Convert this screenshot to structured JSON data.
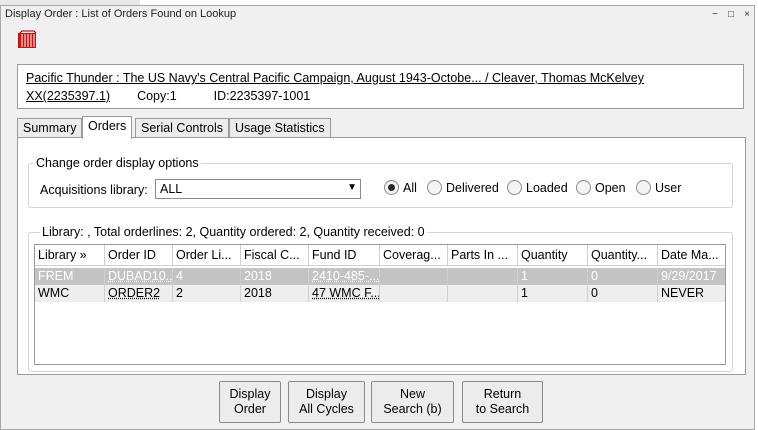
{
  "window": {
    "title": "Display Order : List of Orders Found on Lookup",
    "controls": {
      "minimize": "−",
      "maximize": "□",
      "close": "×"
    }
  },
  "record": {
    "title_line": "Pacific Thunder : The US Navy's Central Pacific Campaign, August 1943-Octobe... / Cleaver, Thomas McKelvey",
    "call_number": "XX(2235397.1)",
    "copy": "Copy:1",
    "id": "ID:2235397-1001"
  },
  "tabs": [
    {
      "label": "Summary",
      "active": false
    },
    {
      "label": "Orders",
      "active": true
    },
    {
      "label": "Serial Controls",
      "active": false
    },
    {
      "label": "Usage Statistics",
      "active": false
    }
  ],
  "options": {
    "legend": "Change order display options",
    "acq_label": "Acquisitions library:",
    "acq_value": "ALL",
    "radios": [
      {
        "label": "All",
        "checked": true
      },
      {
        "label": "Delivered",
        "checked": false
      },
      {
        "label": "Loaded",
        "checked": false
      },
      {
        "label": "Open",
        "checked": false
      },
      {
        "label": "User",
        "checked": false
      }
    ]
  },
  "summary": {
    "legend": "Library: , Total orderlines: 2, Quantity ordered: 2, Quantity received: 0"
  },
  "table": {
    "columns": [
      "Library »",
      "Order ID",
      "Order Li...",
      "Fiscal C...",
      "Fund ID",
      "Coverag...",
      "Parts In ...",
      "Quantity",
      "Quantity...",
      "Date Ma..."
    ],
    "rows": [
      [
        "FREM",
        "DUBAD10...",
        "4",
        "2018",
        "2410-485-...",
        "",
        "",
        "1",
        "0",
        "9/29/2017"
      ],
      [
        "WMC",
        "ORDER2",
        "2",
        "2018",
        "47 WMC F...",
        "",
        "",
        "1",
        "0",
        "NEVER"
      ]
    ]
  },
  "buttons": {
    "display_order": [
      "Display",
      "Order"
    ],
    "display_all_cycles": [
      "Display",
      "All Cycles"
    ],
    "new_search": [
      "New",
      "Search (b)"
    ],
    "return_to_search": [
      "Return",
      "to Search"
    ]
  },
  "colors": {
    "selected_row": "#c3c3c3",
    "icon_red": "#cc1111"
  }
}
